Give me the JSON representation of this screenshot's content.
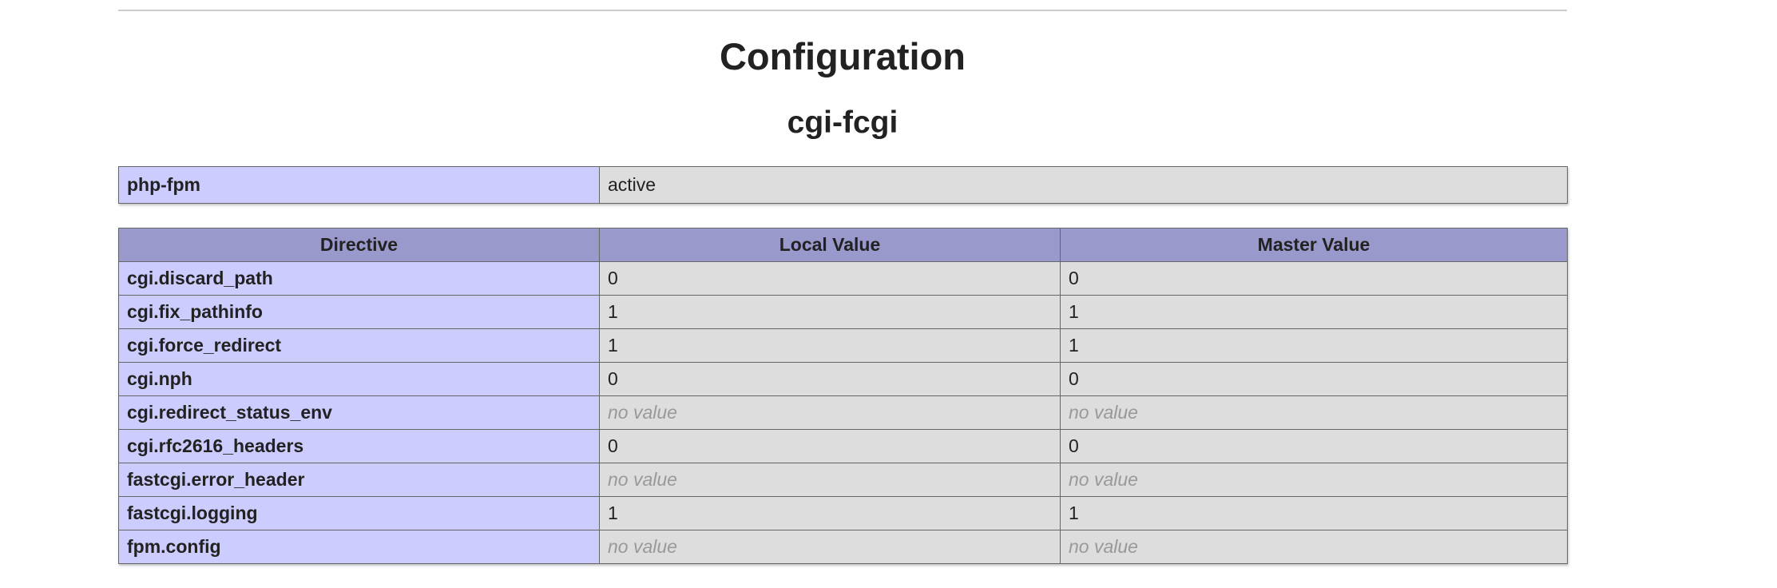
{
  "section": {
    "title": "Configuration"
  },
  "module": {
    "title": "cgi-fcgi"
  },
  "status_table": {
    "rows": [
      {
        "name": "php-fpm",
        "value": "active"
      }
    ]
  },
  "directives_table": {
    "headers": [
      "Directive",
      "Local Value",
      "Master Value"
    ],
    "rows": [
      {
        "directive": "cgi.discard_path",
        "local": "0",
        "master": "0",
        "local_no_value": false,
        "master_no_value": false
      },
      {
        "directive": "cgi.fix_pathinfo",
        "local": "1",
        "master": "1",
        "local_no_value": false,
        "master_no_value": false
      },
      {
        "directive": "cgi.force_redirect",
        "local": "1",
        "master": "1",
        "local_no_value": false,
        "master_no_value": false
      },
      {
        "directive": "cgi.nph",
        "local": "0",
        "master": "0",
        "local_no_value": false,
        "master_no_value": false
      },
      {
        "directive": "cgi.redirect_status_env",
        "local": "no value",
        "master": "no value",
        "local_no_value": true,
        "master_no_value": true
      },
      {
        "directive": "cgi.rfc2616_headers",
        "local": "0",
        "master": "0",
        "local_no_value": false,
        "master_no_value": false
      },
      {
        "directive": "fastcgi.error_header",
        "local": "no value",
        "master": "no value",
        "local_no_value": true,
        "master_no_value": true
      },
      {
        "directive": "fastcgi.logging",
        "local": "1",
        "master": "1",
        "local_no_value": false,
        "master_no_value": false
      },
      {
        "directive": "fpm.config",
        "local": "no value",
        "master": "no value",
        "local_no_value": true,
        "master_no_value": true
      }
    ]
  },
  "colors": {
    "header_bg": "#9999cc",
    "directive_bg": "#ccccff",
    "value_bg": "#dddddd",
    "no_value_text": "#999999",
    "rule": "#cccccc"
  }
}
